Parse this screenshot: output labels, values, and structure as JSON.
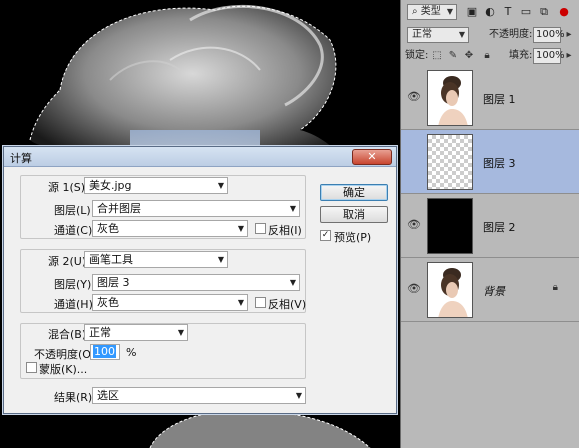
{
  "layers_panel": {
    "filter_kind": "类型",
    "blend_mode": "正常",
    "opacity_label": "不透明度:",
    "opacity_value": "100%",
    "lock_label": "锁定:",
    "fill_label": "填充:",
    "fill_value": "100%",
    "layers": [
      {
        "name": "图层 1",
        "thumb": "portrait",
        "selected": false,
        "italic": false,
        "locked": false
      },
      {
        "name": "图层 3",
        "thumb": "transparent",
        "selected": true,
        "italic": false,
        "locked": false
      },
      {
        "name": "图层 2",
        "thumb": "black",
        "selected": false,
        "italic": false,
        "locked": false
      },
      {
        "name": "背景",
        "thumb": "portrait",
        "selected": false,
        "italic": true,
        "locked": true
      }
    ]
  },
  "dialog": {
    "title": "计算",
    "close_symbol": "✕",
    "source1": {
      "label": "源 1(S):",
      "value": "美女.jpg",
      "layer_label": "图层(L):",
      "layer_value": "合并图层",
      "channel_label": "通道(C):",
      "channel_value": "灰色",
      "invert_label": "反相(I)",
      "invert_checked": false
    },
    "source2": {
      "label": "源 2(U):",
      "value": "画笔工具",
      "layer_label": "图层(Y):",
      "layer_value": "图层 3",
      "channel_label": "通道(H):",
      "channel_value": "灰色",
      "invert_label": "反相(V)",
      "invert_checked": false
    },
    "blending": {
      "label": "混合(B):",
      "value": "正常",
      "opacity_label": "不透明度(O):",
      "opacity_value": "100",
      "opacity_unit": "%",
      "mask_label": "蒙版(K)...",
      "mask_checked": false
    },
    "result": {
      "label": "结果(R):",
      "value": "选区"
    },
    "ok_label": "确定",
    "cancel_label": "取消",
    "preview_label": "预览(P)",
    "preview_checked": true
  }
}
